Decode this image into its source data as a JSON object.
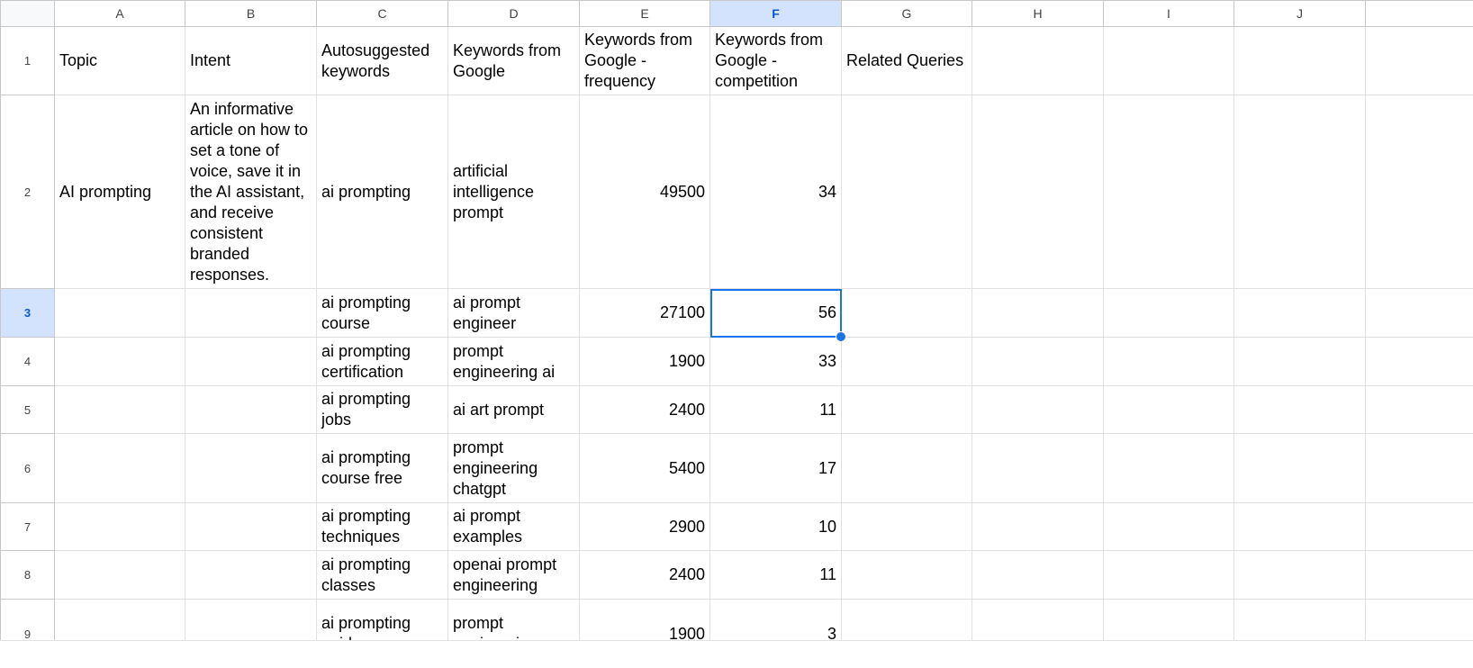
{
  "columns": [
    "A",
    "B",
    "C",
    "D",
    "E",
    "F",
    "G",
    "H",
    "I",
    "J",
    ""
  ],
  "selected": {
    "column": "F",
    "row": "3"
  },
  "accent_color": "#1a73e8",
  "rows": [
    {
      "num": "1",
      "cells": [
        "Topic",
        "Intent",
        "Autosuggested keywords",
        "Keywords from Google",
        "Keywords from Google - frequency",
        "Keywords from Google - competition",
        "Related Queries",
        "",
        "",
        "",
        ""
      ]
    },
    {
      "num": "2",
      "cells": [
        "AI prompting",
        "An informative article on how to set a tone of voice, save it in the AI assistant, and receive consistent branded responses.",
        "ai prompting",
        "artificial intelligence prompt",
        "49500",
        "34",
        "",
        "",
        "",
        "",
        ""
      ]
    },
    {
      "num": "3",
      "cells": [
        "",
        "",
        "ai prompting course",
        "ai prompt engineer",
        "27100",
        "56",
        "",
        "",
        "",
        "",
        ""
      ]
    },
    {
      "num": "4",
      "cells": [
        "",
        "",
        "ai prompting certification",
        "prompt engineering ai",
        "1900",
        "33",
        "",
        "",
        "",
        "",
        ""
      ]
    },
    {
      "num": "5",
      "cells": [
        "",
        "",
        "ai prompting jobs",
        "ai art prompt",
        "2400",
        "11",
        "",
        "",
        "",
        "",
        ""
      ]
    },
    {
      "num": "6",
      "cells": [
        "",
        "",
        "ai prompting course free",
        "prompt engineering chatgpt",
        "5400",
        "17",
        "",
        "",
        "",
        "",
        ""
      ]
    },
    {
      "num": "7",
      "cells": [
        "",
        "",
        "ai prompting techniques",
        "ai prompt examples",
        "2900",
        "10",
        "",
        "",
        "",
        "",
        ""
      ]
    },
    {
      "num": "8",
      "cells": [
        "",
        "",
        "ai prompting classes",
        "openai prompt engineering",
        "2400",
        "11",
        "",
        "",
        "",
        "",
        ""
      ]
    },
    {
      "num": "9",
      "cells": [
        "",
        "",
        "ai prompting guide",
        "prompt engineering",
        "1900",
        "3",
        "",
        "",
        "",
        "",
        ""
      ]
    }
  ]
}
